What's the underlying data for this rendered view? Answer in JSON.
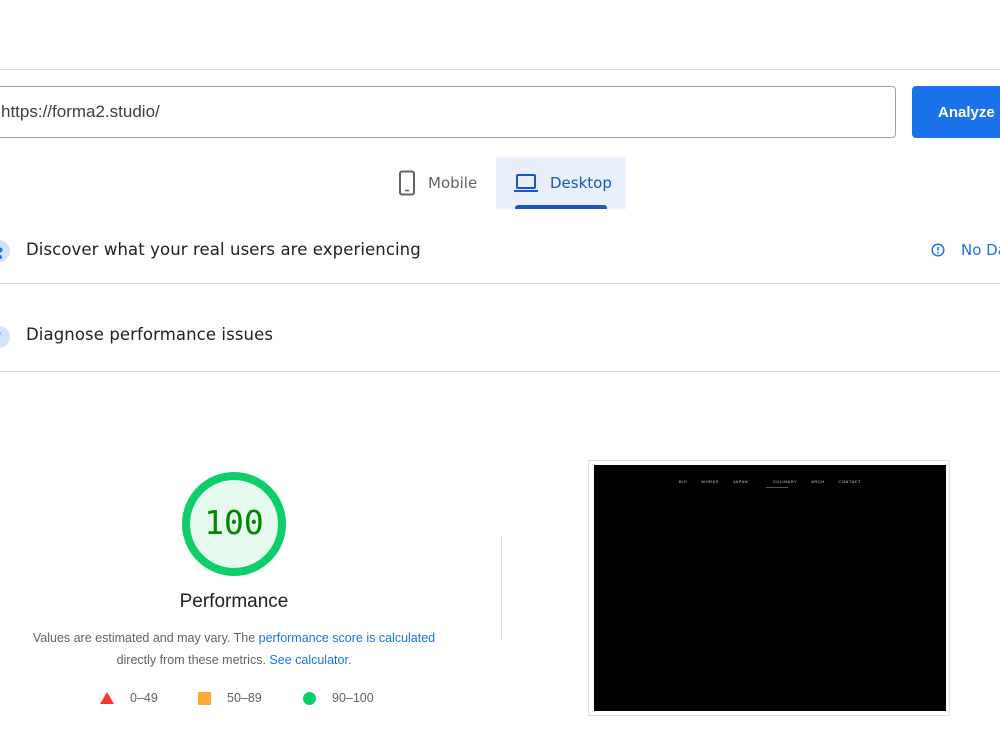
{
  "search": {
    "url_value": "https://forma2.studio/",
    "analyze_label": "Analyze"
  },
  "device_tabs": [
    {
      "label": "Mobile",
      "icon": "phone-icon",
      "active": false
    },
    {
      "label": "Desktop",
      "icon": "laptop-icon",
      "active": true
    }
  ],
  "sections": {
    "discover": {
      "title": "Discover what your real users are experiencing",
      "status": "No Da"
    },
    "diagnose": {
      "title": "Diagnose performance issues"
    }
  },
  "performance": {
    "score": "100",
    "score_fraction": 1.0,
    "title": "Performance",
    "desc_part1": "Values are estimated and may vary. The ",
    "desc_link1": "performance score is calculated",
    "desc_part2": "directly from these metrics. ",
    "desc_link2": "See calculator",
    "desc_part3": "."
  },
  "legend": {
    "fail": "0–49",
    "average": "50–89",
    "pass": "90–100"
  },
  "thumbnail": {
    "nav": [
      "BIO",
      "WORKS",
      "JAPAN",
      "CULINARY",
      "ARCH",
      "CONTACT"
    ]
  },
  "colors": {
    "accent": "#1a73e8",
    "pass": "#0cce6b",
    "average": "#ffaa33",
    "fail": "#ff3333",
    "score_text": "#008800"
  }
}
